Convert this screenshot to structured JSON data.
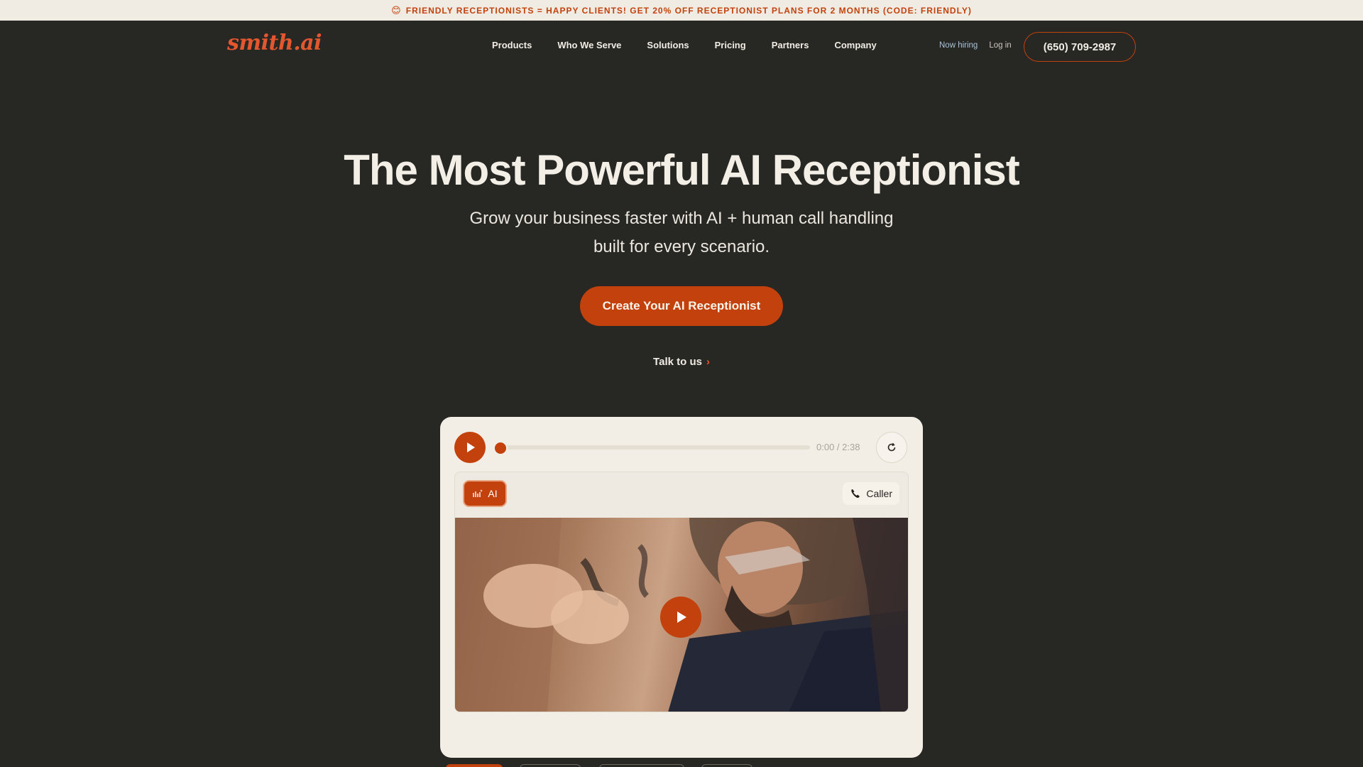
{
  "promo_bar": {
    "emoji": "😊",
    "text": "FRIENDLY RECEPTIONISTS = HAPPY CLIENTS! GET 20% OFF RECEPTIONIST PLANS FOR 2 MONTHS (CODE: FRIENDLY)"
  },
  "header": {
    "logo": "smith.ai",
    "nav": [
      "Products",
      "Who We Serve",
      "Solutions",
      "Pricing",
      "Partners",
      "Company"
    ],
    "now_hiring": "Now hiring",
    "login": "Log in",
    "phone": "(650) 709-2987"
  },
  "hero": {
    "title": "The Most Powerful AI Receptionist",
    "subtitle": "Grow your business faster with AI + human call handling built for every scenario.",
    "cta": "Create Your AI Receptionist",
    "secondary_link": "Talk to us",
    "secondary_chevron": "›"
  },
  "player": {
    "time": "0:00 / 2:38",
    "progress": 0,
    "ai_label": "AI",
    "caller_label": "Caller"
  },
  "colors": {
    "background": "#272724",
    "accent": "#c2410c",
    "card": "#f2eee6"
  }
}
